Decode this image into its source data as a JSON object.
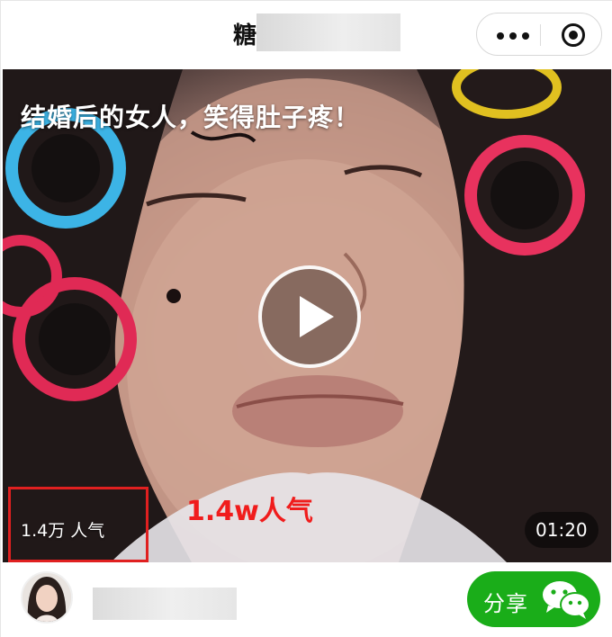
{
  "header": {
    "title_visible": "糖",
    "menu_icon": "more-dots-icon",
    "close_icon": "target-icon"
  },
  "video": {
    "caption": "结婚后的女人，笑得肚子疼！",
    "views": "1.4万 人气",
    "annotation": "1.4w人气",
    "duration": "01:20",
    "play_icon": "play-icon"
  },
  "footer": {
    "share_label": "分享",
    "share_icon": "wechat-icon"
  },
  "colors": {
    "share_green": "#1aad19",
    "annotation_red": "#f01c1c"
  }
}
